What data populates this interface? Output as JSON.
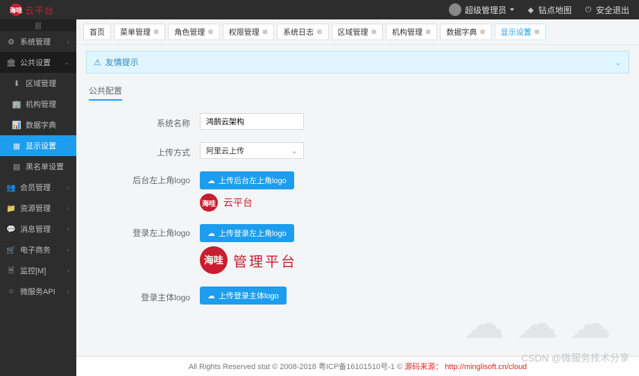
{
  "brand": {
    "badge": "海哇",
    "name": "云平台"
  },
  "top": {
    "user": "超级管理员",
    "sitemap": "钻点地图",
    "logout": "安全退出"
  },
  "sidebar": {
    "groups": [
      {
        "icon": "⚙",
        "label": "系统管理",
        "type": "parent"
      },
      {
        "icon": "🏛",
        "label": "公共设置",
        "type": "parent-open"
      },
      {
        "icon": "⬇",
        "label": "区域管理",
        "type": "sub"
      },
      {
        "icon": "🏢",
        "label": "机构管理",
        "type": "sub"
      },
      {
        "icon": "📊",
        "label": "数据字典",
        "type": "sub"
      },
      {
        "icon": "▦",
        "label": "显示设置",
        "type": "sub-active"
      },
      {
        "icon": "▤",
        "label": "黑名单设置",
        "type": "sub"
      },
      {
        "icon": "👥",
        "label": "会员管理",
        "type": "parent"
      },
      {
        "icon": "📁",
        "label": "资源管理",
        "type": "parent"
      },
      {
        "icon": "💬",
        "label": "消息管理",
        "type": "parent"
      },
      {
        "icon": "🛒",
        "label": "电子商务",
        "type": "parent"
      },
      {
        "icon": "🗎",
        "label": "监控[M]",
        "type": "parent"
      },
      {
        "icon": "○",
        "label": "微服务API",
        "type": "parent"
      }
    ]
  },
  "tabs": [
    {
      "label": "首页",
      "closable": false
    },
    {
      "label": "菜单管理",
      "closable": true
    },
    {
      "label": "角色管理",
      "closable": true
    },
    {
      "label": "权限管理",
      "closable": true
    },
    {
      "label": "系统日志",
      "closable": true
    },
    {
      "label": "区域管理",
      "closable": true
    },
    {
      "label": "机构管理",
      "closable": true
    },
    {
      "label": "数据字典",
      "closable": true
    },
    {
      "label": "显示设置",
      "closable": true,
      "active": true
    }
  ],
  "alert": {
    "title": "友情提示"
  },
  "section": "公共配置",
  "form": {
    "sys_name_label": "系统名称",
    "sys_name_value": "鸿鹄云架构",
    "upload_mode_label": "上传方式",
    "upload_mode_value": "阿里云上传",
    "logo_top_label": "后台左上角logo",
    "logo_top_btn": "上传后台左上角logo",
    "logo_top_preview_text": "云平台",
    "logo_login_label": "登录左上角logo",
    "logo_login_btn": "上传登录左上角logo",
    "logo_login_preview_text": "管理平台",
    "logo_main_label": "登录主体logo",
    "logo_main_btn": "上传登录主体logo"
  },
  "footer": {
    "copyright": "All Rights Reserved stat © 2008-2018 粤ICP备16101510号-1 ©",
    "src_label": "源码来源：",
    "src_link": "http://minglisoft.cn/cloud"
  },
  "watermark": "CSDN @微服务技术分享"
}
